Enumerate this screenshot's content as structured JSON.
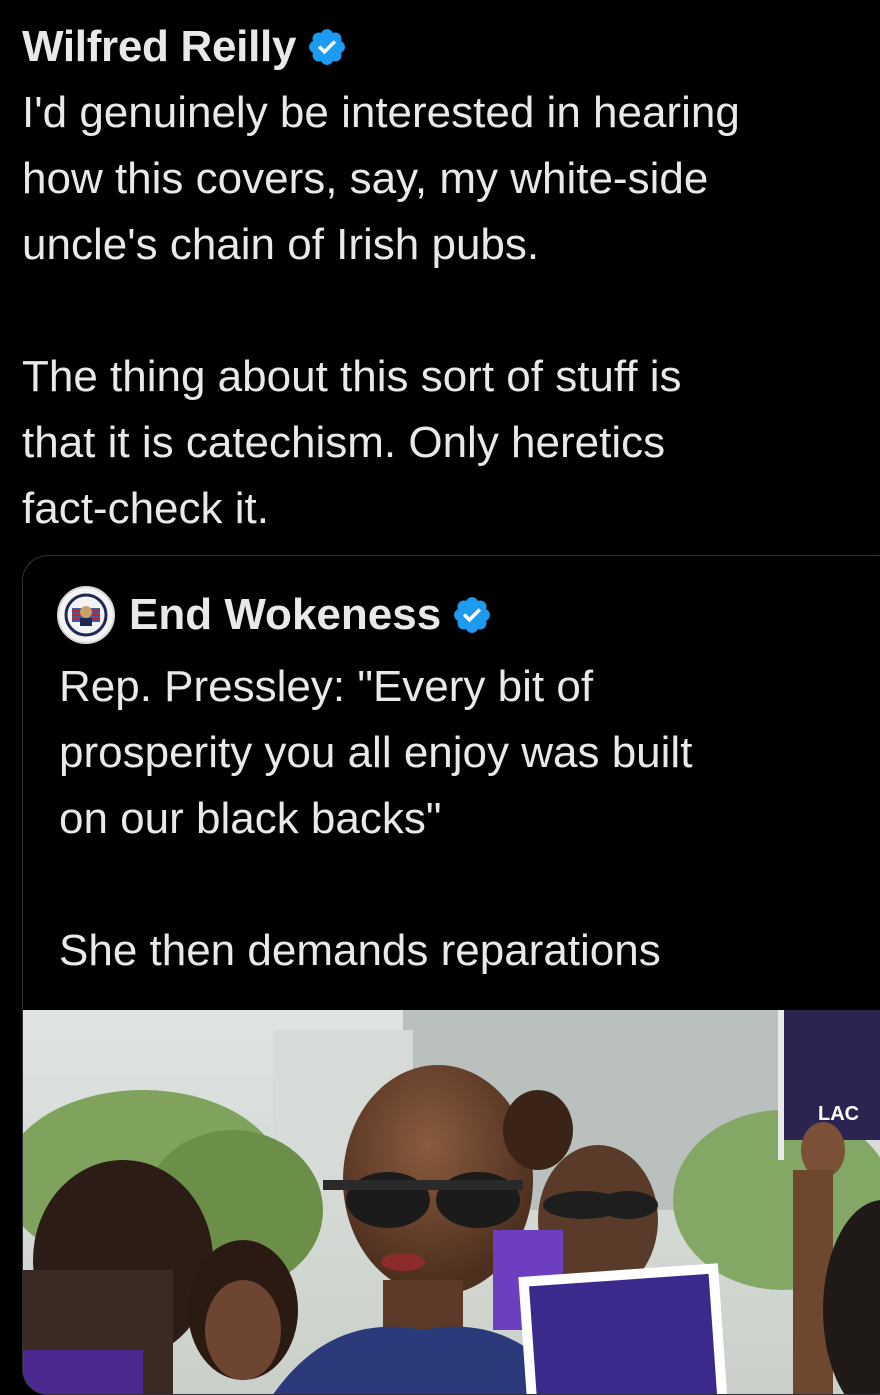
{
  "tweet": {
    "author_name": "Wilfred Reilly",
    "verified_icon": "verified-badge-icon",
    "text": "I'd genuinely be interested in hearing\nhow this covers, say, my white-side\nuncle's chain of Irish pubs.\n\nThe thing about this sort of stuff is\nthat it is catechism. Only heretics\nfact-check it."
  },
  "quote": {
    "author_name": "End Wokeness",
    "avatar_icon": "profile-avatar-icon",
    "verified_icon": "verified-badge-icon",
    "text": "Rep. Pressley: \"Every bit of\nprosperity you all enjoy was built\non our black backs\"\n\nShe then demands reparations",
    "media": {
      "type": "video-thumbnail"
    }
  },
  "colors": {
    "background": "#000000",
    "text": "#e7e9ea",
    "verified": "#1d9bf0",
    "border": "#2f3336"
  }
}
